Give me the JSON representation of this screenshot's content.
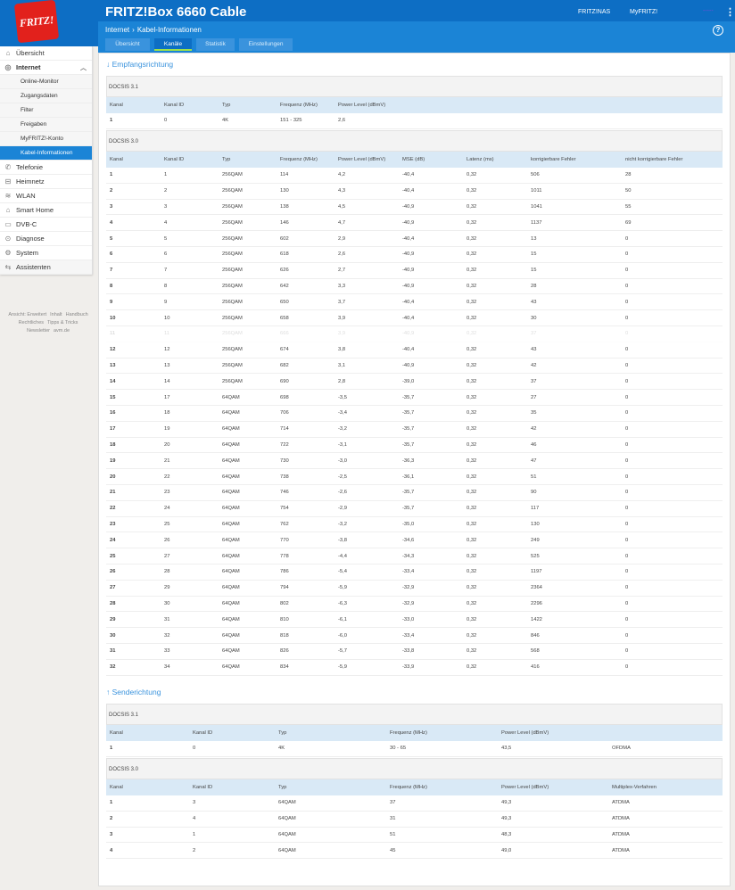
{
  "header": {
    "brand": "FRITZ!",
    "title": "FRITZ!Box 6660 Cable",
    "nas": "FRITZ!NAS",
    "myfritz": "MyFRITZ!",
    "user": "-----",
    "menu": "⋮"
  },
  "breadcrumb": {
    "part1": "Internet",
    "sep": "›",
    "part2": "Kabel-Informationen"
  },
  "tabs": [
    "Übersicht",
    "Kanäle",
    "Statistik",
    "Einstellungen"
  ],
  "help": "?",
  "sidebar": {
    "items": [
      {
        "label": "Übersicht",
        "icon": "home-icon",
        "glyph": "⌂"
      },
      {
        "label": "Internet",
        "icon": "globe-icon",
        "glyph": "◎",
        "expanded": true
      },
      {
        "label": "Telefonie",
        "icon": "phone-icon",
        "glyph": "✆"
      },
      {
        "label": "Heimnetz",
        "icon": "network-icon",
        "glyph": "⊟"
      },
      {
        "label": "WLAN",
        "icon": "wifi-icon",
        "glyph": "≋"
      },
      {
        "label": "Smart Home",
        "icon": "smarthome-icon",
        "glyph": "⌂"
      },
      {
        "label": "DVB-C",
        "icon": "tv-icon",
        "glyph": "▭"
      },
      {
        "label": "Diagnose",
        "icon": "diagnose-icon",
        "glyph": "⊙"
      },
      {
        "label": "System",
        "icon": "system-icon",
        "glyph": "⚙"
      },
      {
        "label": "Assistenten",
        "icon": "assistant-icon",
        "glyph": "⇆"
      }
    ],
    "internet_sub": [
      "Online-Monitor",
      "Zugangsdaten",
      "Filter",
      "Freigaben",
      "MyFRITZ!-Konto",
      "Kabel-Informationen"
    ],
    "footer": [
      [
        "Ansicht: Erweitert",
        "Inhalt",
        "Handbuch"
      ],
      [
        "Rechtliches",
        "Tipps & Tricks"
      ],
      [
        "Newsletter",
        "avm.de"
      ]
    ]
  },
  "down": {
    "heading": "↓ Empfangsrichtung",
    "docsis31_title": "DOCSIS 3.1",
    "docsis31_headers": [
      "Kanal",
      "Kanal ID",
      "Typ",
      "Frequenz (MHz)",
      "Power Level (dBmV)"
    ],
    "docsis31_rows": [
      [
        "1",
        "0",
        "4K",
        "151 - 325",
        "2,6"
      ]
    ],
    "docsis30_title": "DOCSIS 3.0",
    "docsis30_headers": [
      "Kanal",
      "Kanal ID",
      "Typ",
      "Frequenz (MHz)",
      "Power Level (dBmV)",
      "MSE (dB)",
      "Latenz (ms)",
      "korrigierbare Fehler",
      "nicht korrigierbare Fehler"
    ],
    "docsis30_rows": [
      [
        "1",
        "1",
        "256QAM",
        "114",
        "4,2",
        "-40,4",
        "0,32",
        "506",
        "28"
      ],
      [
        "2",
        "2",
        "256QAM",
        "130",
        "4,3",
        "-40,4",
        "0,32",
        "1011",
        "50"
      ],
      [
        "3",
        "3",
        "256QAM",
        "138",
        "4,5",
        "-40,9",
        "0,32",
        "1041",
        "55"
      ],
      [
        "4",
        "4",
        "256QAM",
        "146",
        "4,7",
        "-40,9",
        "0,32",
        "1137",
        "69"
      ],
      [
        "5",
        "5",
        "256QAM",
        "602",
        "2,9",
        "-40,4",
        "0,32",
        "13",
        "0"
      ],
      [
        "6",
        "6",
        "256QAM",
        "618",
        "2,6",
        "-40,9",
        "0,32",
        "15",
        "0"
      ],
      [
        "7",
        "7",
        "256QAM",
        "626",
        "2,7",
        "-40,9",
        "0,32",
        "15",
        "0"
      ],
      [
        "8",
        "8",
        "256QAM",
        "642",
        "3,3",
        "-40,9",
        "0,32",
        "28",
        "0"
      ],
      [
        "9",
        "9",
        "256QAM",
        "650",
        "3,7",
        "-40,4",
        "0,32",
        "43",
        "0"
      ],
      [
        "10",
        "10",
        "256QAM",
        "658",
        "3,9",
        "-40,4",
        "0,32",
        "30",
        "0"
      ],
      [
        "11",
        "11",
        "256QAM",
        "666",
        "3,9",
        "-40,9",
        "0,32",
        "37",
        "0"
      ],
      [
        "12",
        "12",
        "256QAM",
        "674",
        "3,8",
        "-40,4",
        "0,32",
        "43",
        "0"
      ],
      [
        "13",
        "13",
        "256QAM",
        "682",
        "3,1",
        "-40,9",
        "0,32",
        "42",
        "0"
      ],
      [
        "14",
        "14",
        "256QAM",
        "690",
        "2,8",
        "-39,0",
        "0,32",
        "37",
        "0"
      ],
      [
        "15",
        "17",
        "64QAM",
        "698",
        "-3,5",
        "-35,7",
        "0,32",
        "27",
        "0"
      ],
      [
        "16",
        "18",
        "64QAM",
        "706",
        "-3,4",
        "-35,7",
        "0,32",
        "35",
        "0"
      ],
      [
        "17",
        "19",
        "64QAM",
        "714",
        "-3,2",
        "-35,7",
        "0,32",
        "42",
        "0"
      ],
      [
        "18",
        "20",
        "64QAM",
        "722",
        "-3,1",
        "-35,7",
        "0,32",
        "46",
        "0"
      ],
      [
        "19",
        "21",
        "64QAM",
        "730",
        "-3,0",
        "-36,3",
        "0,32",
        "47",
        "0"
      ],
      [
        "20",
        "22",
        "64QAM",
        "738",
        "-2,5",
        "-36,1",
        "0,32",
        "51",
        "0"
      ],
      [
        "21",
        "23",
        "64QAM",
        "746",
        "-2,6",
        "-35,7",
        "0,32",
        "90",
        "0"
      ],
      [
        "22",
        "24",
        "64QAM",
        "754",
        "-2,9",
        "-35,7",
        "0,32",
        "117",
        "0"
      ],
      [
        "23",
        "25",
        "64QAM",
        "762",
        "-3,2",
        "-35,0",
        "0,32",
        "130",
        "0"
      ],
      [
        "24",
        "26",
        "64QAM",
        "770",
        "-3,8",
        "-34,6",
        "0,32",
        "249",
        "0"
      ],
      [
        "25",
        "27",
        "64QAM",
        "778",
        "-4,4",
        "-34,3",
        "0,32",
        "525",
        "0"
      ],
      [
        "26",
        "28",
        "64QAM",
        "786",
        "-5,4",
        "-33,4",
        "0,32",
        "1197",
        "0"
      ],
      [
        "27",
        "29",
        "64QAM",
        "794",
        "-5,9",
        "-32,9",
        "0,32",
        "2364",
        "0"
      ],
      [
        "28",
        "30",
        "64QAM",
        "802",
        "-6,3",
        "-32,9",
        "0,32",
        "2296",
        "0"
      ],
      [
        "29",
        "31",
        "64QAM",
        "810",
        "-6,1",
        "-33,0",
        "0,32",
        "1422",
        "0"
      ],
      [
        "30",
        "32",
        "64QAM",
        "818",
        "-6,0",
        "-33,4",
        "0,32",
        "846",
        "0"
      ],
      [
        "31",
        "33",
        "64QAM",
        "826",
        "-5,7",
        "-33,8",
        "0,32",
        "568",
        "0"
      ],
      [
        "32",
        "34",
        "64QAM",
        "834",
        "-5,9",
        "-33,9",
        "0,32",
        "416",
        "0"
      ]
    ]
  },
  "up": {
    "heading": "↑ Senderichtung",
    "docsis31_title": "DOCSIS 3.1",
    "docsis31_headers": [
      "Kanal",
      "Kanal ID",
      "Typ",
      "Frequenz (MHz)",
      "Power Level (dBmV)",
      ""
    ],
    "docsis31_rows": [
      [
        "1",
        "0",
        "4K",
        "30 - 65",
        "43,5",
        "OFDMA"
      ]
    ],
    "docsis30_title": "DOCSIS 3.0",
    "docsis30_headers": [
      "Kanal",
      "Kanal ID",
      "Typ",
      "Frequenz (MHz)",
      "Power Level (dBmV)",
      "Multiplex-Verfahren"
    ],
    "docsis30_rows": [
      [
        "1",
        "3",
        "64QAM",
        "37",
        "49,3",
        "ATDMA"
      ],
      [
        "2",
        "4",
        "64QAM",
        "31",
        "49,3",
        "ATDMA"
      ],
      [
        "3",
        "1",
        "64QAM",
        "51",
        "48,3",
        "ATDMA"
      ],
      [
        "4",
        "2",
        "64QAM",
        "45",
        "49,0",
        "ATDMA"
      ]
    ]
  }
}
